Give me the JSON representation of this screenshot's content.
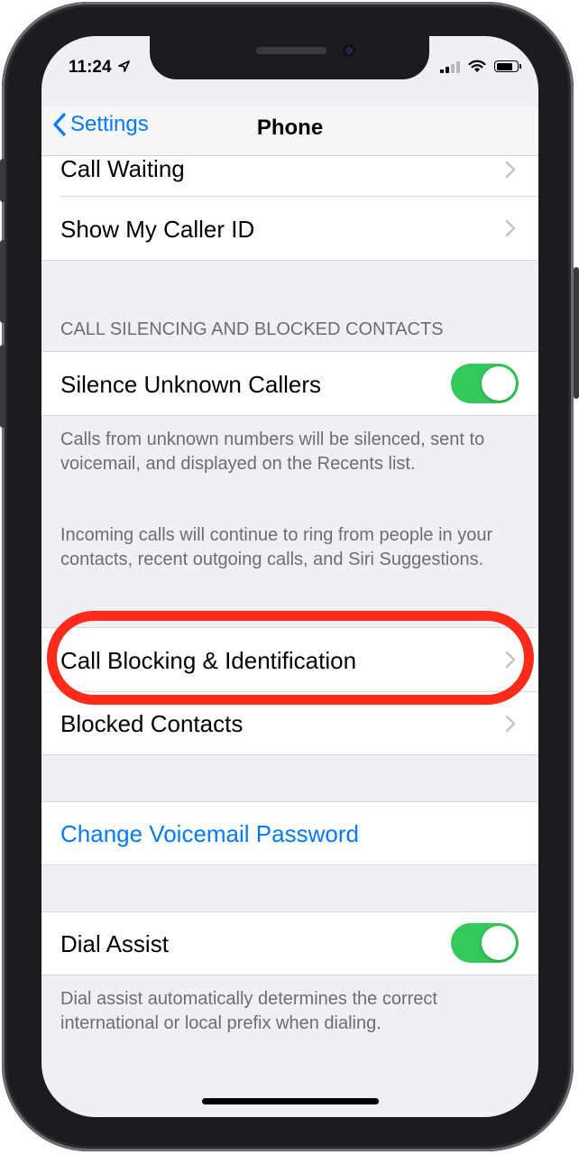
{
  "status_bar": {
    "time": "11:24"
  },
  "nav": {
    "back_label": "Settings",
    "title": "Phone"
  },
  "rows": {
    "call_waiting": "Call Waiting",
    "show_caller_id": "Show My Caller ID",
    "silence_unknown": "Silence Unknown Callers",
    "call_blocking": "Call Blocking & Identification",
    "blocked_contacts": "Blocked Contacts",
    "change_voicemail": "Change Voicemail Password",
    "dial_assist": "Dial Assist"
  },
  "sections": {
    "call_silencing_header": "CALL SILENCING AND BLOCKED CONTACTS"
  },
  "footnotes": {
    "silence_1": "Calls from unknown numbers will be silenced, sent to voicemail, and displayed on the Recents list.",
    "silence_2": "Incoming calls will continue to ring from people in your contacts, recent outgoing calls, and Siri Suggestions.",
    "dial_assist": "Dial assist automatically determines the correct international or local prefix when dialing."
  },
  "toggles": {
    "silence_unknown_on": true,
    "dial_assist_on": true
  },
  "colors": {
    "accent": "#007aff",
    "toggle_on": "#34c759",
    "highlight": "#ff2a1a"
  }
}
